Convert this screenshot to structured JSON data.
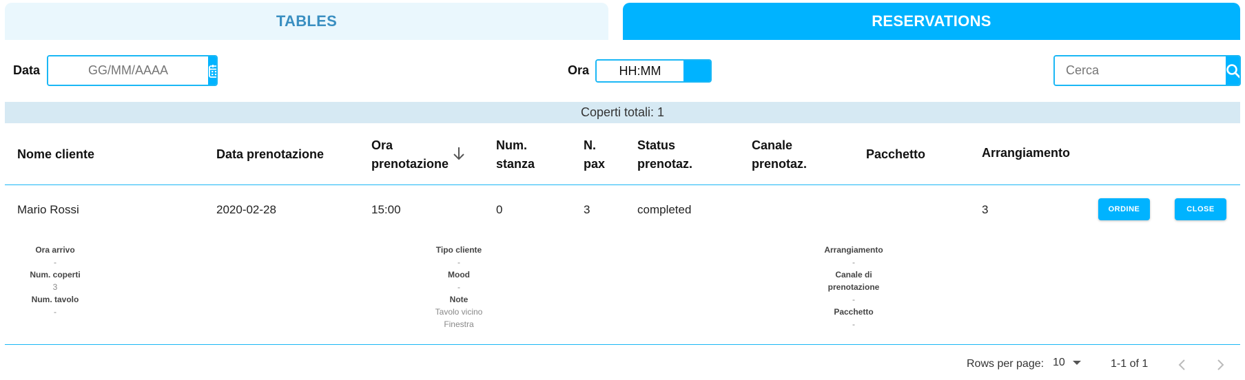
{
  "tabs": {
    "tables": "TABLES",
    "reservations": "RESERVATIONS"
  },
  "filters": {
    "date_label": "Data",
    "date_placeholder": "GG/MM/AAAA",
    "time_label": "Ora",
    "time_value": "HH:MM",
    "search_placeholder": "Cerca"
  },
  "totals": "Coperti totali: 1",
  "table": {
    "headers": {
      "nome_cliente": "Nome cliente",
      "data_prenotazione": "Data prenotazione",
      "ora_line1": "Ora",
      "ora_line2": "prenotazione",
      "num_line1": "Num.",
      "num_line2": "stanza",
      "pax_line1": "N.",
      "pax_line2": "pax",
      "status_line1": "Status",
      "status_line2": "prenotaz.",
      "canale_line1": "Canale",
      "canale_line2": "prenotaz.",
      "pacchetto": "Pacchetto",
      "arrangiamento": "Arrangiamento"
    },
    "rows": [
      {
        "nome": "Mario Rossi",
        "data": "2020-02-28",
        "ora": "15:00",
        "stanza": "0",
        "pax": "3",
        "status": "completed",
        "canale": "",
        "pacchetto": "",
        "arrangiamento": "3",
        "btn_ordine": "ORDINE",
        "btn_close": "CLOSE"
      }
    ]
  },
  "details": {
    "col1": {
      "ora_arrivo_label": "Ora arrivo",
      "ora_arrivo_value": "-",
      "num_coperti_label": "Num. coperti",
      "num_coperti_value": "3",
      "num_tavolo_label": "Num. tavolo",
      "num_tavolo_value": "-"
    },
    "col2": {
      "tipo_cliente_label": "Tipo cliente",
      "tipo_cliente_value": "-",
      "mood_label": "Mood",
      "mood_value": "-",
      "note_label": "Note",
      "note_value_line1": "Tavolo vicino",
      "note_value_line2": "Finestra"
    },
    "col3": {
      "arrangiamento_label": "Arrangiamento",
      "arrangiamento_value": "-",
      "canale_label_line1": "Canale di",
      "canale_label_line2": "prenotazione",
      "canale_value": "-",
      "pacchetto_label": "Pacchetto",
      "pacchetto_value": "-"
    }
  },
  "footer": {
    "rows_per_page_label": "Rows per page:",
    "rows_per_page_value": "10",
    "range": "1-1 of 1"
  },
  "colors": {
    "accent": "#00b3ff",
    "tab_inactive_bg": "#eaf7fd",
    "tab_inactive_text": "#3a8fc1",
    "totals_bg": "#d6e9f3"
  },
  "icons": {
    "calendar": "calendar-icon",
    "search": "search-icon",
    "sort": "arrow-down-icon",
    "dropdown": "caret-down-icon",
    "prev": "chevron-left-icon",
    "next": "chevron-right-icon"
  }
}
